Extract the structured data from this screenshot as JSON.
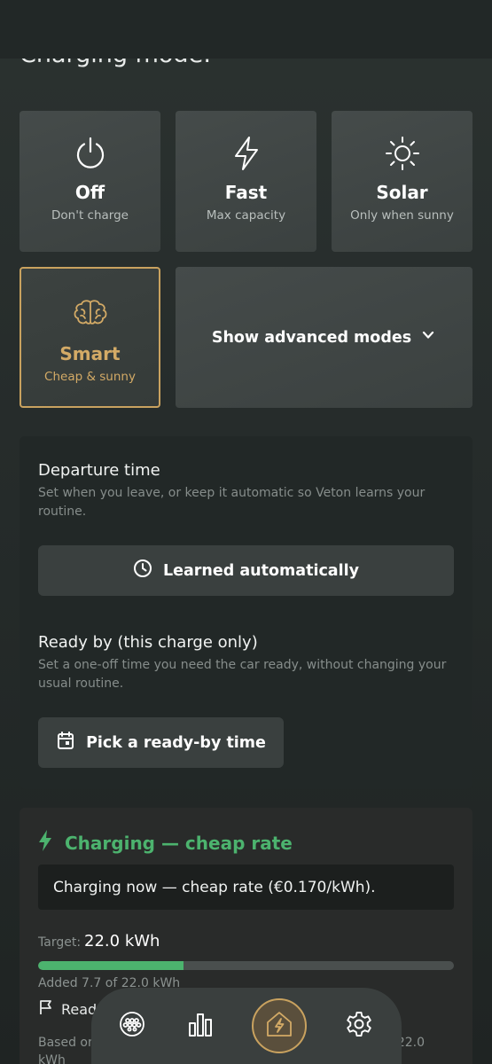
{
  "section_title": "Charging mode:",
  "modes": [
    {
      "name": "Off",
      "sub": "Don't charge",
      "icon": "power-icon"
    },
    {
      "name": "Fast",
      "sub": "Max capacity",
      "icon": "lightning-icon"
    },
    {
      "name": "Solar",
      "sub": "Only when sunny",
      "icon": "sun-icon"
    },
    {
      "name": "Smart",
      "sub": "Cheap & sunny",
      "icon": "brain-icon",
      "selected": true
    }
  ],
  "advanced": {
    "label": "Show advanced modes",
    "icon": "chevron-down-icon"
  },
  "departure": {
    "title": "Departure time",
    "desc": "Set when you leave, or keep it automatic so Veton learns your routine.",
    "button": "Learned automatically",
    "ready_title": "Ready by (this charge only)",
    "ready_desc": "Set a one-off time you need the car ready, without changing your usual routine.",
    "ready_button": "Pick a ready-by time"
  },
  "charging": {
    "title": "Charging — cheap rate",
    "note": "Charging now — cheap rate (€0.170/kWh).",
    "target_label": "Target:",
    "target_value": "22.0 kWh",
    "progress": 0.35,
    "added": "Added 7.7 of 22.0 kWh",
    "ready_text": "Read",
    "based_text": "Based on",
    "based_value": "22.0",
    "based_unit": "kWh"
  },
  "nav": {
    "items": [
      "charger-plug-icon",
      "stats-icon",
      "home-charge-icon",
      "settings-icon"
    ],
    "active": "home-charge-icon"
  },
  "colors": {
    "accent_gold": "#c9a25f",
    "accent_green": "#4cb36e"
  }
}
